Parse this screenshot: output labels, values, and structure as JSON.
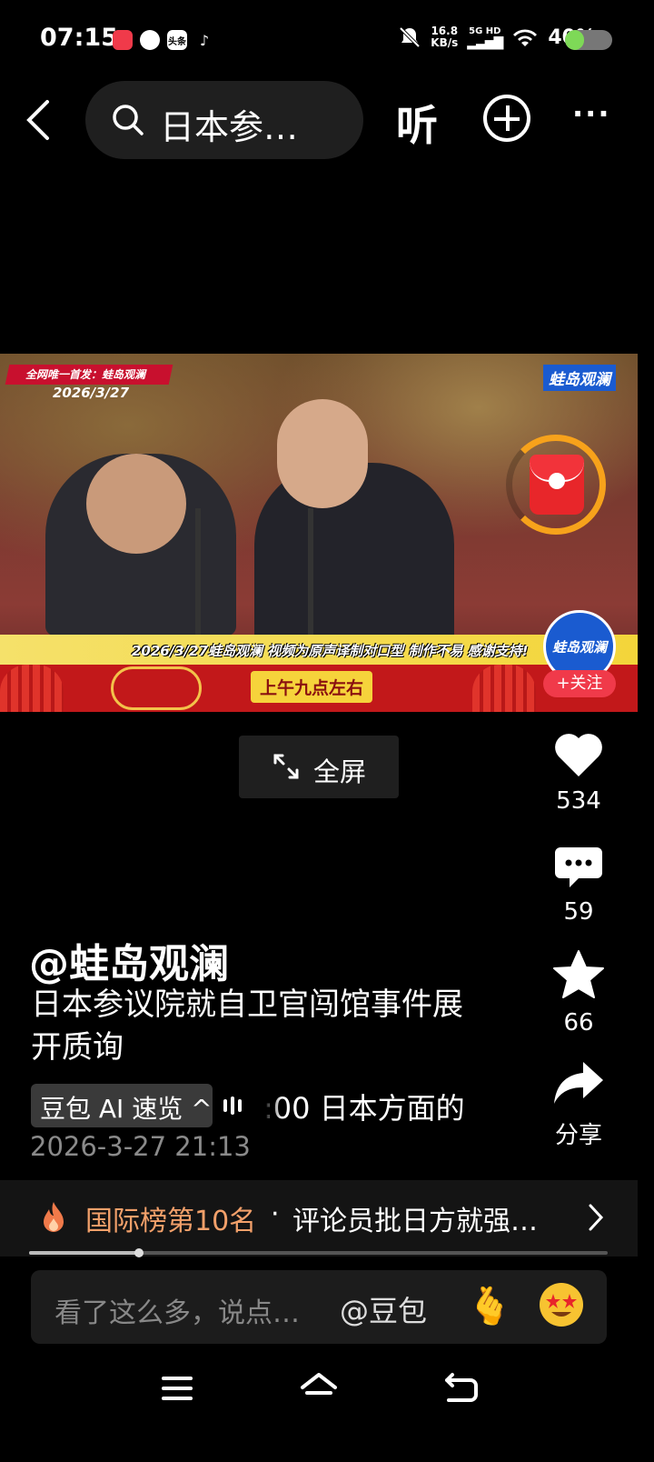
{
  "status_bar": {
    "time": "07:15",
    "app_badges": [
      "头条"
    ],
    "net_speed_value": "16.8",
    "net_speed_unit": "KB/s",
    "network": "5G HD",
    "battery": "40%",
    "battery_level": 0.4
  },
  "top_nav": {
    "search_text": "日本参…",
    "listen_label": "听"
  },
  "video": {
    "top_banner": "全网唯一首发：蛙岛观澜",
    "date_overlay": "2026/3/27",
    "channel_logo": "蛙岛观澜",
    "caption_strip": "2026/3/27蛙岛观澜 视频为原声译制对口型 制作不易 感谢支持!",
    "subtitle": "上午九点左右",
    "avatar_text": "蛙岛观澜",
    "follow_label": "+关注"
  },
  "fullscreen_label": "全屏",
  "actions": {
    "like_count": "534",
    "comment_count": "59",
    "favorite_count": "66",
    "share_label": "分享"
  },
  "post": {
    "author": "@蛙岛观澜",
    "title": "日本参议院就自卫官闯馆事件展开质询",
    "ai_summary_label": "豆包 AI 速览",
    "ai_summary_chevron": "^",
    "ticker_text": ":00 日本方面的",
    "date": "2026-3-27 21:13"
  },
  "rank_bar": {
    "rank": "国际榜第10名",
    "separator": "·",
    "description": "评论员批日方就强…"
  },
  "progress": 0.19,
  "comment_bar": {
    "placeholder": "看了这么多，说点…",
    "at_label": "@豆包"
  },
  "colors": {
    "accent_orange": "#f2a06a",
    "battery_green": "#7ed957",
    "timer_ring": "#f7a21b",
    "follow_red": "#f03a4a"
  }
}
